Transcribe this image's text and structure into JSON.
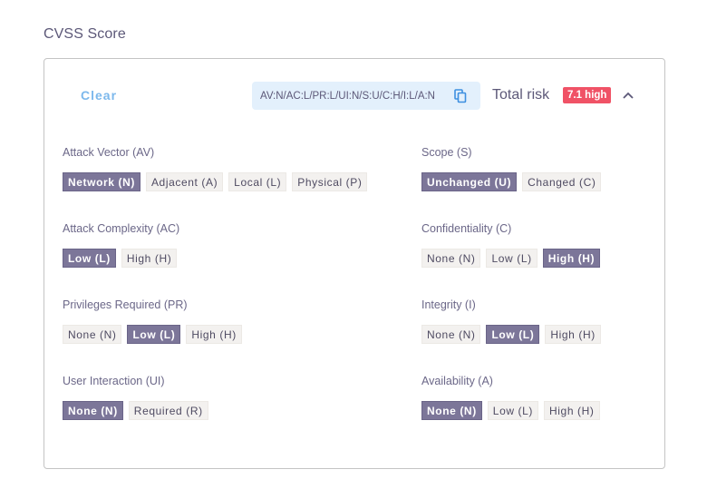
{
  "section": {
    "title": "CVSS Score"
  },
  "header": {
    "clear_label": "Clear",
    "vector_string": "AV:N/AC:L/PR:L/UI:N/S:U/C:H/I:L/A:N",
    "copy_icon": "copy-icon",
    "total_risk_label": "Total risk",
    "risk_badge": "7.1 high",
    "collapse_icon": "chevron-up-icon",
    "colors": {
      "badge": "#f05266",
      "selected": "#7c7699",
      "clear": "#7cb8ec",
      "vector_bg": "#e3f0fc"
    }
  },
  "metrics": {
    "av": {
      "label": "Attack Vector (AV)",
      "options": [
        "Network (N)",
        "Adjacent (A)",
        "Local (L)",
        "Physical (P)"
      ],
      "selected": 0
    },
    "ac": {
      "label": "Attack Complexity (AC)",
      "options": [
        "Low (L)",
        "High (H)"
      ],
      "selected": 0
    },
    "pr": {
      "label": "Privileges Required (PR)",
      "options": [
        "None (N)",
        "Low (L)",
        "High (H)"
      ],
      "selected": 1
    },
    "ui": {
      "label": "User Interaction (UI)",
      "options": [
        "None (N)",
        "Required (R)"
      ],
      "selected": 0
    },
    "s": {
      "label": "Scope (S)",
      "options": [
        "Unchanged (U)",
        "Changed (C)"
      ],
      "selected": 0
    },
    "c": {
      "label": "Confidentiality (C)",
      "options": [
        "None (N)",
        "Low (L)",
        "High (H)"
      ],
      "selected": 2
    },
    "i": {
      "label": "Integrity (I)",
      "options": [
        "None (N)",
        "Low (L)",
        "High (H)"
      ],
      "selected": 1
    },
    "a": {
      "label": "Availability (A)",
      "options": [
        "None (N)",
        "Low (L)",
        "High (H)"
      ],
      "selected": 0
    }
  }
}
